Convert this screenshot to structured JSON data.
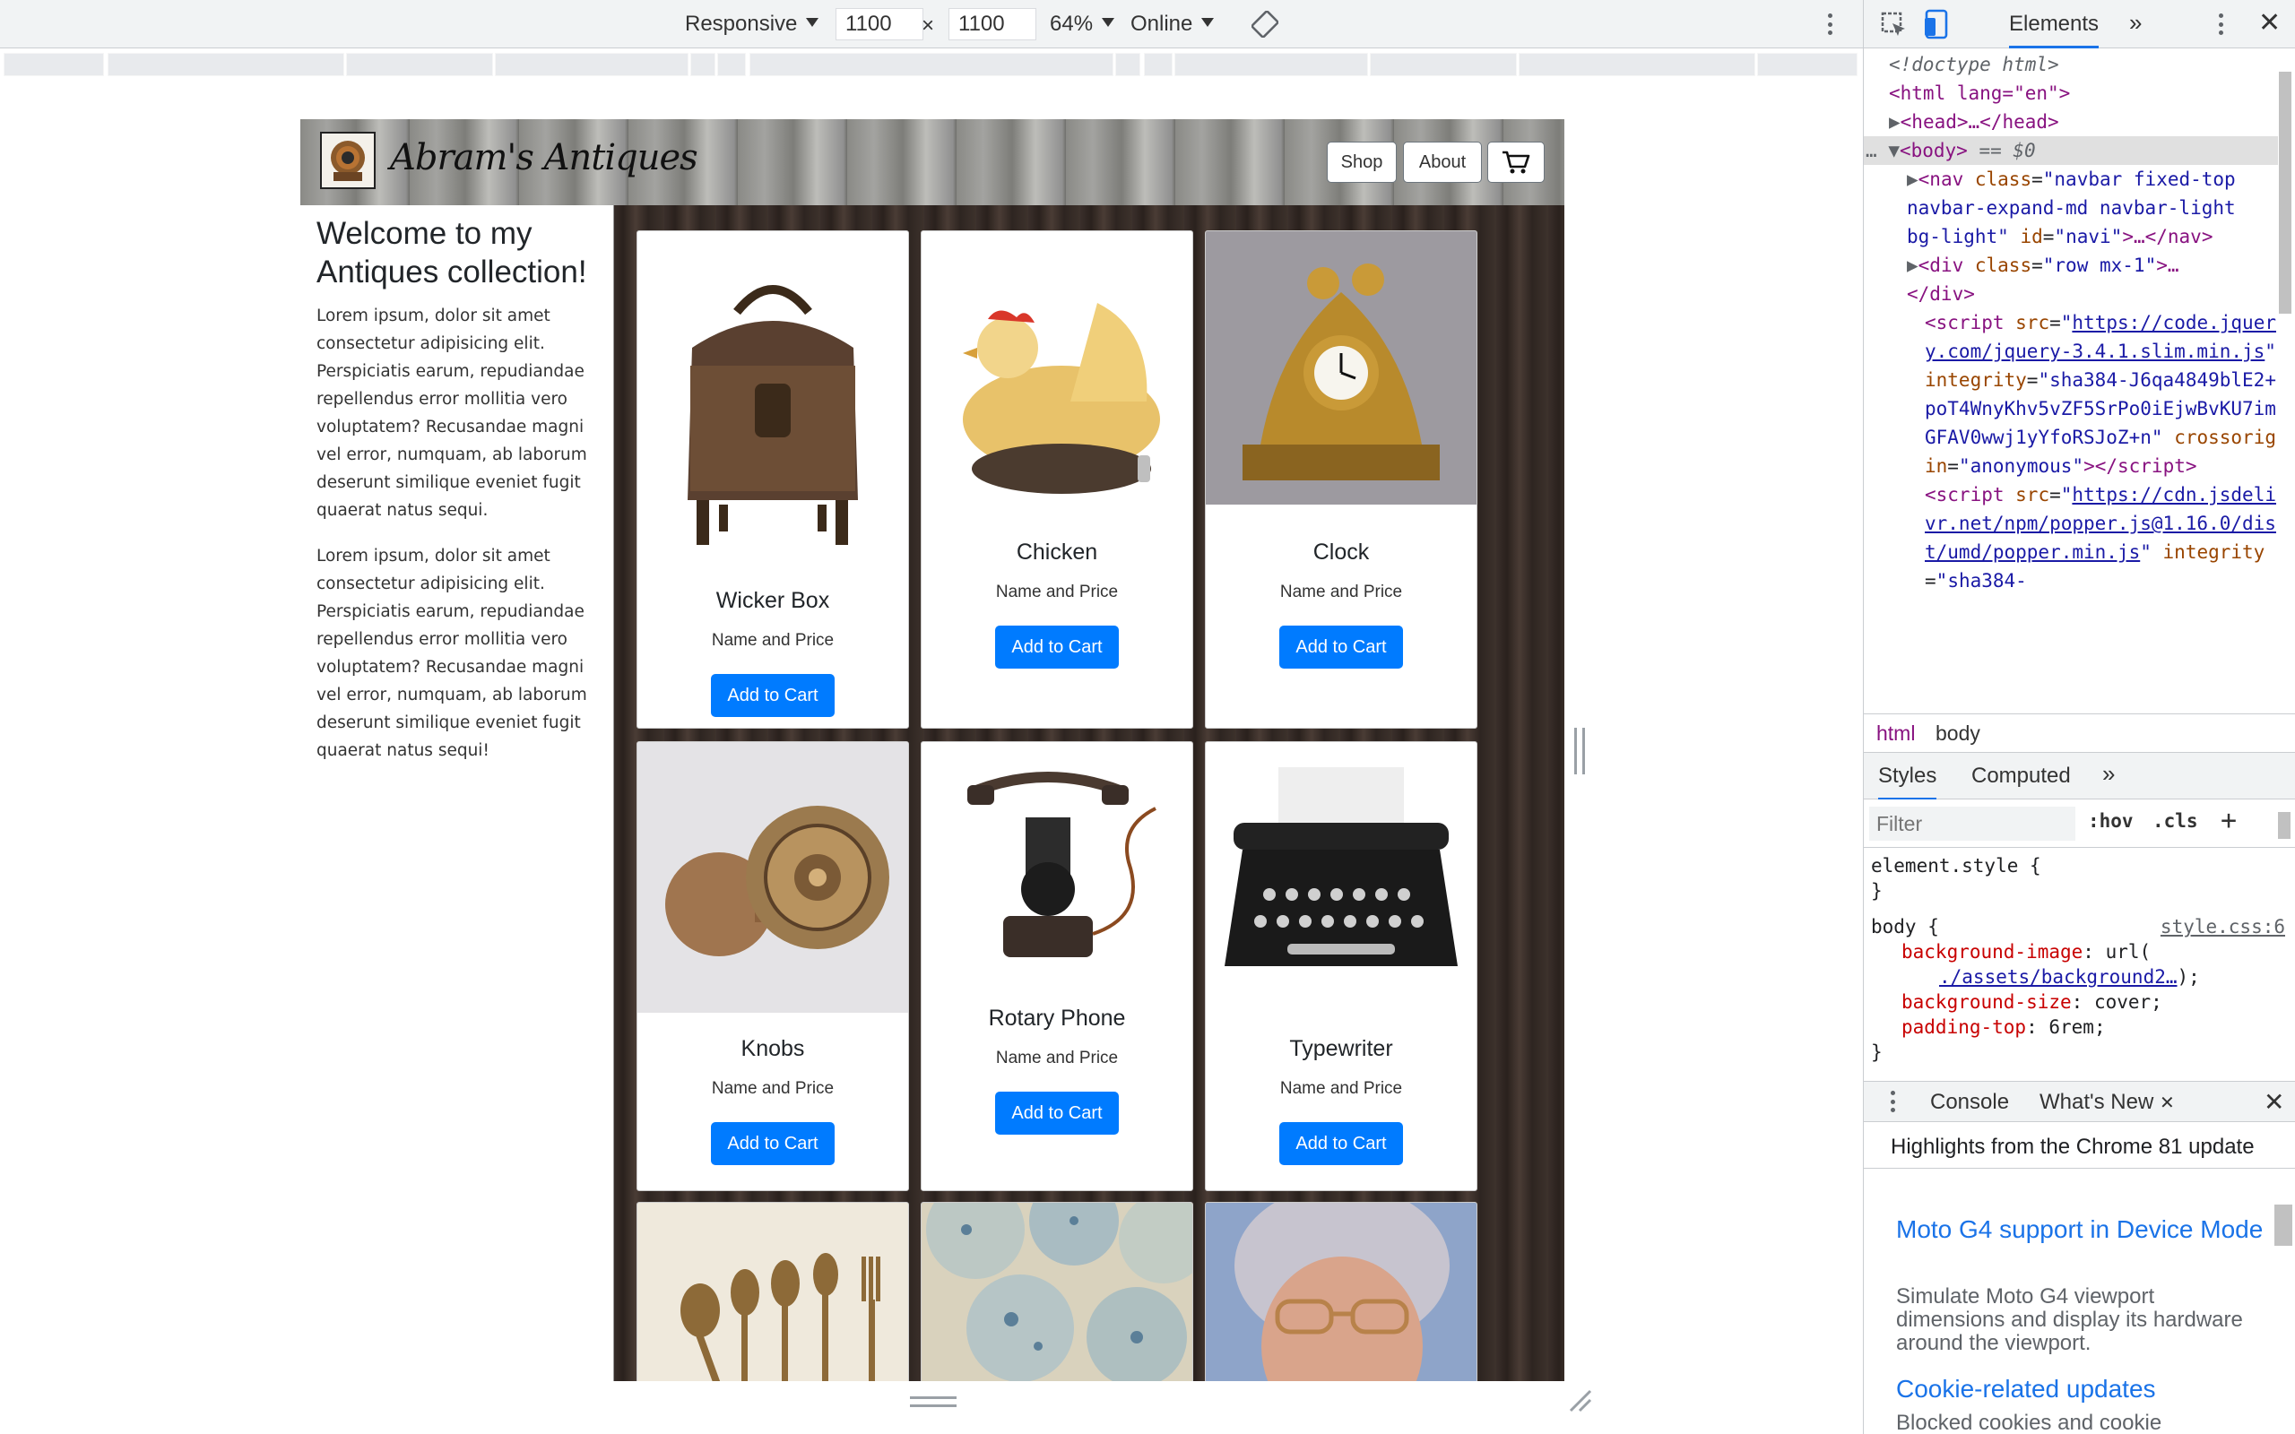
{
  "device_toolbar": {
    "device": "Responsive",
    "width": "1100",
    "times": "×",
    "height": "1100",
    "zoom": "64%",
    "network": "Online"
  },
  "site": {
    "brand": "Abram's Antiques",
    "nav": {
      "shop": "Shop",
      "about": "About"
    },
    "intro": {
      "heading": "Welcome to my Antiques collection!",
      "paragraphs": [
        "Lorem ipsum, dolor sit amet consectetur adipisicing elit. Perspiciatis earum, repudiandae repellendus error mollitia vero voluptatem? Recusandae magni vel error, numquam, ab laborum deserunt similique eveniet fugit quaerat natus sequi.",
        "Lorem ipsum, dolor sit amet consectetur adipisicing elit. Perspiciatis earum, repudiandae repellendus error mollitia vero voluptatem? Recusandae magni vel error, numquam, ab laborum deserunt similique eveniet fugit quaerat natus sequi!"
      ]
    },
    "products": [
      {
        "title": "Wicker Box",
        "subtitle": "Name and Price",
        "button": "Add to Cart"
      },
      {
        "title": "Chicken",
        "subtitle": "Name and Price",
        "button": "Add to Cart"
      },
      {
        "title": "Clock",
        "subtitle": "Name and Price",
        "button": "Add to Cart"
      },
      {
        "title": "Knobs",
        "subtitle": "Name and Price",
        "button": "Add to Cart"
      },
      {
        "title": "Rotary Phone",
        "subtitle": "Name and Price",
        "button": "Add to Cart"
      },
      {
        "title": "Typewriter",
        "subtitle": "Name and Price",
        "button": "Add to Cart"
      }
    ]
  },
  "devtools": {
    "tab": "Elements",
    "dom": {
      "doctype": "<!doctype html>",
      "html_open": "<html lang=\"en\">",
      "head": "<head>…</head>",
      "body_open": "<body>",
      "body_marker": "== $0",
      "nav_class": "navbar fixed-top navbar-expand-md navbar-light bg-light",
      "nav_id": "navi",
      "div_class": "row mx-1",
      "script1_src": "https://code.jquery.com/jquery-3.4.1.slim.min.js",
      "script1_integrity": "sha384-J6qa4849blE2+poT4WnyKhv5vZF5SrPo0iEjwBvKU7imGFAV0wwj1yYfoRSJoZ+n",
      "script1_crossorigin": "anonymous",
      "script2_src": "https://cdn.jsdelivr.net/npm/popper.js@1.16.0/dist/umd/popper.min.js",
      "script2_integrity": "sha384-"
    },
    "breadcrumbs": [
      "html",
      "body"
    ],
    "styles_tabs": [
      "Styles",
      "Computed"
    ],
    "filter_placeholder": "Filter",
    "hov": ":hov",
    "cls": ".cls",
    "element_style": "element.style {",
    "close_brace": "}",
    "rule_selector": "body {",
    "rule_source": "style.css:6",
    "rule_props": [
      {
        "name": "background-image",
        "value": "url(",
        "link": "./assets/background2…",
        "tail": ");"
      },
      {
        "name": "background-size",
        "value": "cover;"
      },
      {
        "name": "padding-top",
        "value": "6rem;"
      }
    ],
    "drawer_tabs": {
      "console": "Console",
      "whatsnew": "What's New"
    },
    "whatsnew": {
      "highlights": "Highlights from the Chrome 81 update",
      "items": [
        {
          "title": "Moto G4 support in Device Mode",
          "desc": "Simulate Moto G4 viewport dimensions and display its hardware around the viewport."
        },
        {
          "title": "Cookie-related updates",
          "desc": "Blocked cookies and cookie"
        }
      ]
    }
  }
}
